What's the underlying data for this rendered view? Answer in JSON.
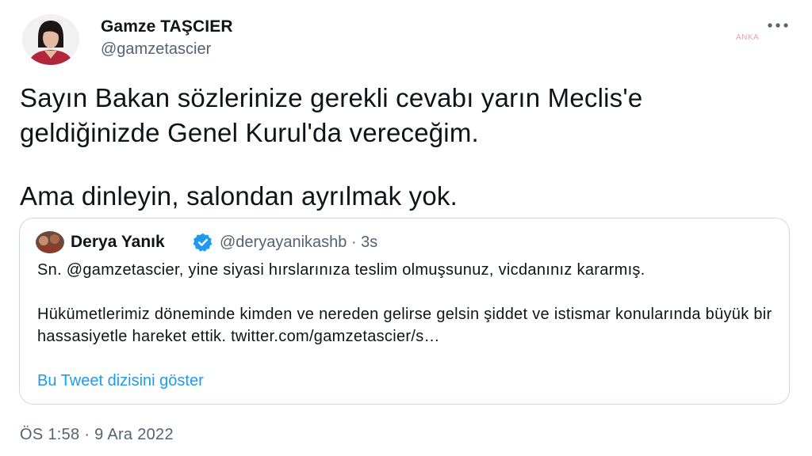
{
  "author": {
    "name": "Gamze TAŞCIER",
    "handle": "@gamzetascier"
  },
  "watermark": "ANKA",
  "tweet": {
    "paragraph_1": "Sayın Bakan sözlerinize gerekli cevabı yarın Meclis'e geldiğinizde Genel Kurul'da vereceğim.",
    "paragraph_2": "Ama dinleyin, salondan ayrılmak yok."
  },
  "quote": {
    "name": "Derya Yanık",
    "handle_time": "@deryayanikashb · 3s",
    "paragraph_1": "Sn. @gamzetascier, yine siyasi hırslarınıza teslim olmuşsunuz, vicdanınız kararmış.",
    "paragraph_2": "Hükümetlerimiz döneminde kimden ve nereden gelirse gelsin şiddet ve istismar konularında büyük bir hassasiyetle hareket ettik. twitter.com/gamzetascier/s…",
    "show_thread": "Bu Tweet dizisini göster"
  },
  "timestamp": "ÖS 1:58 · 9 Ara 2022",
  "colors": {
    "link": "#1d9bf0",
    "verified": "#1d9bf0",
    "secondary_text": "#536471",
    "border": "#cfd9de"
  },
  "icons": {
    "more": "more-dots-icon",
    "verified": "verified-badge-icon"
  }
}
